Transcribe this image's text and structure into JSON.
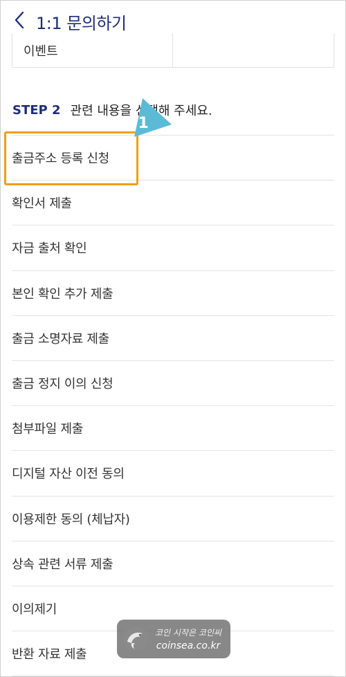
{
  "header": {
    "title": "1:1 문의하기",
    "back_icon": "chevron-left-icon"
  },
  "category": {
    "selected_label": "이벤트"
  },
  "step": {
    "label": "STEP 2",
    "description": "관련 내용을 선택해 주세요."
  },
  "callout": {
    "number": "1",
    "color": "#5bbbd6"
  },
  "highlight": {
    "color": "#f29d12"
  },
  "items": [
    {
      "label": "출금주소 등록 신청"
    },
    {
      "label": "확인서 제출"
    },
    {
      "label": "자금 출처 확인"
    },
    {
      "label": "본인 확인 추가 제출"
    },
    {
      "label": "출금 소명자료 제출"
    },
    {
      "label": "출금 정지 이의 신청"
    },
    {
      "label": "첨부파일 제출"
    },
    {
      "label": "디지털 자산 이전 동의"
    },
    {
      "label": "이용제한 동의 (체납자)"
    },
    {
      "label": "상속 관련 서류 제출"
    },
    {
      "label": "이의제기"
    },
    {
      "label": "반환 자료 제출"
    }
  ],
  "watermark": {
    "line1": "코인 시작은 코인씨",
    "line2": "coinsea.co.kr",
    "logo_icon": "dolphin-icon"
  },
  "colors": {
    "brand": "#1e2d7a",
    "divider": "#e3e3e3"
  }
}
